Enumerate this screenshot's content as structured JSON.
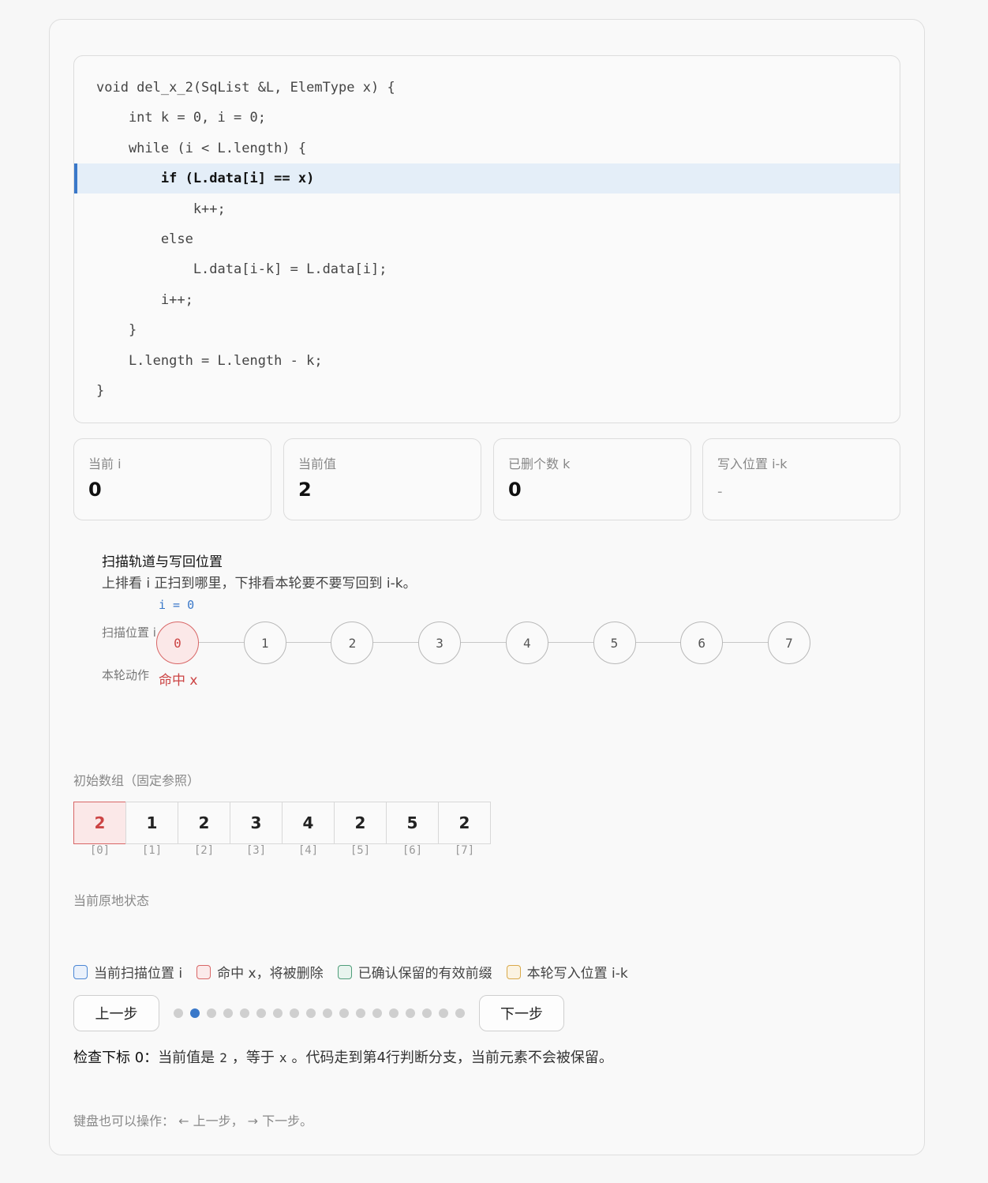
{
  "code_lines": [
    "void del_x_2(SqList &L, ElemType x) {",
    "    int k = 0, i = 0;",
    "    while (i < L.length) {",
    "        if (L.data[i] == x)",
    "            k++;",
    "        else",
    "            L.data[i-k] = L.data[i];",
    "        i++;",
    "    }",
    "    L.length = L.length - k;",
    "}"
  ],
  "active_code_line": 3,
  "stats": [
    {
      "label": "当前 i",
      "value": "0"
    },
    {
      "label": "当前值",
      "value": "2"
    },
    {
      "label": "已删个数 k",
      "value": "0"
    },
    {
      "label": "写入位置 i-k",
      "value": "-"
    }
  ],
  "track": {
    "title": "扫描轨道与写回位置",
    "subtitle": "上排看 i 正扫到哪里，下排看本轮要不要写回到 i-k。",
    "i_marker": "i = 0",
    "scan_label": "扫描位置 i",
    "action_label": "本轮动作",
    "nodes": [
      "0",
      "1",
      "2",
      "3",
      "4",
      "5",
      "6",
      "7"
    ],
    "current_index": 0,
    "action_text": "命中 x"
  },
  "initial_array": {
    "label": "初始数组（固定参照）",
    "values": [
      "2",
      "1",
      "2",
      "3",
      "4",
      "2",
      "5",
      "2"
    ],
    "indices": [
      "[0]",
      "[1]",
      "[2]",
      "[3]",
      "[4]",
      "[5]",
      "[6]",
      "[7]"
    ],
    "hit_index": 0
  },
  "current_state_label": "当前原地状态",
  "legend": [
    {
      "label": "当前扫描位置 i",
      "color": "#4a86d4",
      "fill": "#eaf1fb"
    },
    {
      "label": "命中 x，将被删除",
      "color": "#d86666",
      "fill": "#fbeaea"
    },
    {
      "label": "已确认保留的有效前缀",
      "color": "#4f9d7a",
      "fill": "#e8f4ee"
    },
    {
      "label": "本轮写入位置 i-k",
      "color": "#d9a94a",
      "fill": "#fbf3e2"
    }
  ],
  "controls": {
    "prev_label": "上一步",
    "next_label": "下一步",
    "step_count": 18,
    "current_step": 1
  },
  "description": {
    "lead": "检查下标 0：",
    "t1": "当前值是",
    "c1": "2",
    "t2": "，等于",
    "c2": "x",
    "t3": "。代码走到第4行判断分支，当前元素不会被保留。"
  },
  "keyboard_hint": "键盘也可以操作： ← 上一步， → 下一步。"
}
